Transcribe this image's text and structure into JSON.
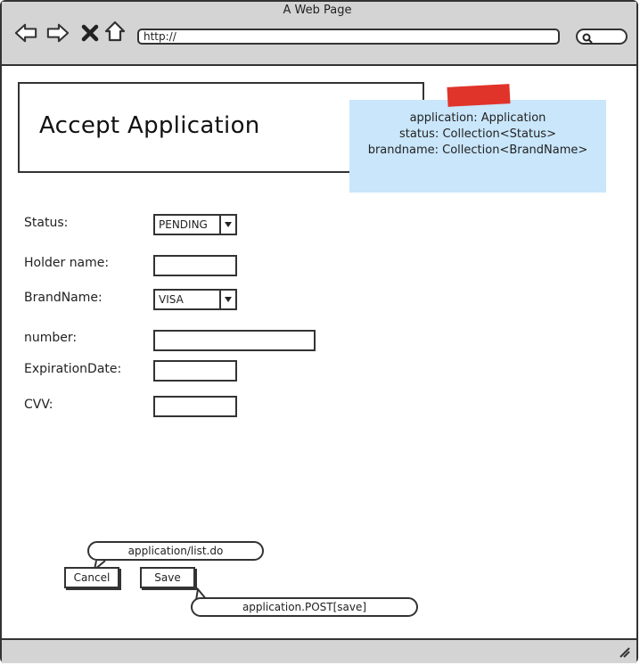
{
  "browser": {
    "title": "A Web Page",
    "url": "http://"
  },
  "page": {
    "heading": "Accept Application"
  },
  "note": {
    "lines": [
      "application: Application",
      "status: Collection<Status>",
      "brandname: Collection<BrandName>"
    ]
  },
  "form": {
    "status_label": "Status:",
    "status_value": "PENDING",
    "holder_label": "Holder name:",
    "holder_value": "",
    "brand_label": "BrandName:",
    "brand_value": "VISA",
    "number_label": "number:",
    "number_value": "",
    "expiration_label": "ExpirationDate:",
    "expiration_value": "",
    "cvv_label": "CVV:",
    "cvv_value": ""
  },
  "actions": {
    "cancel_label": "Cancel",
    "save_label": "Save",
    "cancel_target": "application/list.do",
    "save_target": "application.POST[save]"
  },
  "colors": {
    "chrome": "#d4d4d4",
    "note": "#c9e6fb",
    "tape": "#e0342b"
  }
}
